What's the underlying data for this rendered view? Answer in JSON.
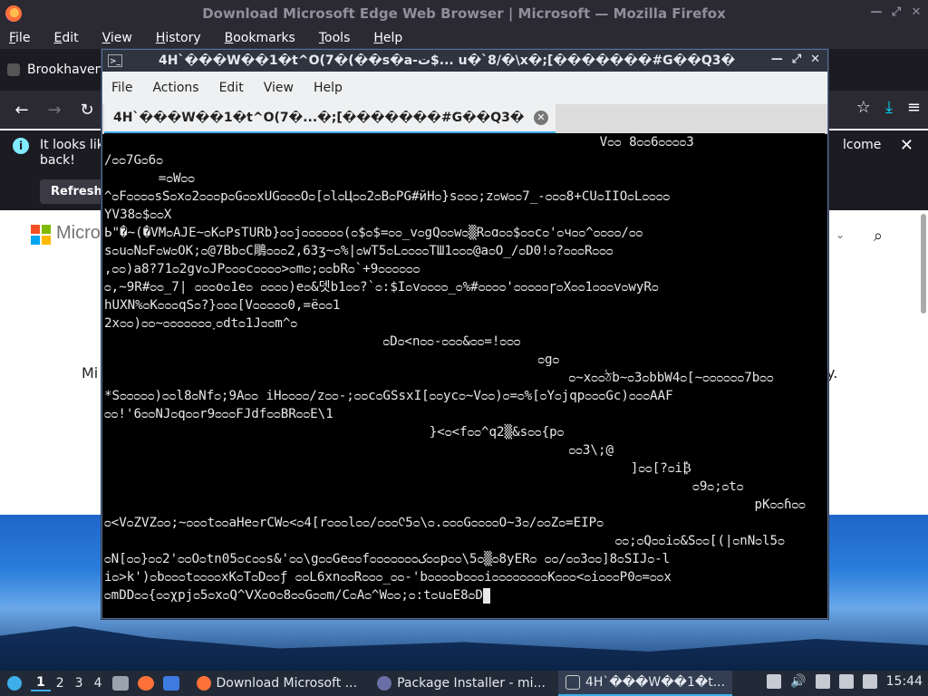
{
  "firefox": {
    "title": "Download Microsoft Edge Web Browser | Microsoft — Mozilla Firefox",
    "menu": [
      "File",
      "Edit",
      "View",
      "History",
      "Bookmarks",
      "Tools",
      "Help"
    ],
    "tab_label": "Brookhaven",
    "notification_text": "It looks lik",
    "notification_text_cont": "back!",
    "notification_text_right": "lcome",
    "refresh_button": "Refresh",
    "page_brand": "Micro",
    "page_text_left": "Mi",
    "page_text_right": "y."
  },
  "terminal": {
    "title": "4H`���W��1�t^O(7�(��s�a-ت$...  u�`8/�\\x�;[�������#G��Q3�",
    "menu": [
      "File",
      "Actions",
      "Edit",
      "View",
      "Help"
    ],
    "tab_label": "4H`���W��1�t^O(7�...�;[�������#G��Q3�",
    "lines": [
      "                                                                Vᴑᴑ 8ᴑᴑ6ᴑᴑᴑᴑ3",
      "/ᴑᴑ7Gᴑ6ᴑ",
      "       =ᴑWᴑᴑ",
      "^ᴑFᴑᴑᴑᴑsSᴑxᴑ2ᴑᴑᴑpᴑGᴑᴑxUGᴑᴑᴑOᴑ[ᴑlᴑЦᴑᴑ2ᴑBᴑPG#йHᴑ}sᴑᴑᴑ;zᴑwᴑᴑ7_-ᴑᴑᴑ8+CUᴑIIOᴑLᴑᴑᴑᴑ",
      "YV38ᴑ$ᴑᴑX",
      "Ь\"�~(�VMᴑAJE~ᴑKᴑPsTURb}ᴑᴑjᴑᴑᴑᴑᴑᴑ(ᴑ$ᴑ$=ᴑᴑ_vᴑgQᴑᴑwᴑ▒Rᴑɑᴑᴑ$ᴑᴑcᴑ'ᴑчᴑᴑ^ᴑᴑᴑᴑ/ᴑᴑ",
      "sᴑuᴑNᴑFᴑwᴑOK;ᴑ@7BbᴑC鵰ᴑᴑᴑ2,63ʒ~ᴑ%|ᴑwT5ᴑLᴑᴑᴑᴑTШ1ᴑᴑᴑ@aᴑO_/ᴑD0!ᴑ?ᴑᴑᴑRᴑᴑᴑ",
      ",ᴑᴑ)a8?71ᴑ2gvᴑJPᴑᴑᴑcᴑᴑᴑᴑ>ᴑmᴑ;ᴑᴑbRᴑ`+9ᴑᴑᴑᴑᴑᴑ",
      "ᴑ,~9R#ᴑᴑ_7| ᴑᴑᴑoᴑ1eᴑ ᴑᴑᴑᴑ)eᴑ&뎃b1ᴑᴑ?`ᴑ:$Iᴑvᴑᴑᴑᴑ_ᴑ%#ᴑᴑᴑᴑ'ᴑᴑᴑᴑᴑɼᴑXᴑᴑ1ᴑᴑᴑvᴑwyRᴑ",
      "hUXN%ᴑKᴑᴑᴑqSᴑ?}ᴑᴑᴑ[Vᴑᴑᴑᴑᴑ0,=ëᴑᴑ1",
      "2xᴑᴑ)ᴑᴑ~ᴑᴑᴑᴑᴑᴑᴑ˯ᴑdtᴑ1Jᴑᴑm^ᴑ",
      "                                    ᴑDᴑ<nᴑᴑ-ᴑᴑᴑ&ᴑᴑ=!ᴑᴑᴑ",
      "                                                        ᴑgᴑ",
      "                                                            ᴑ~xᴑᴑঠb~ᴑ3ᴑbbW4ᴑ[~ᴑᴑᴑᴑᴑᴑ7bᴑᴑ",
      "*Sᴑᴑᴑᴑᴑ)ᴑᴑl8ᴑNfᴑ;9Aᴑᴑ iHᴑᴑᴑᴑ/zᴑᴑ-;ᴑᴑcᴑGSsxI[ᴑᴑycᴑ~Vᴑᴑ)ᴑ=ᴑ%[ᴑYᴑjqpᴑᴑᴑGc)ᴑᴑᴑAAF",
      "ᴑᴑ!'6ᴑᴑNJᴑqᴑᴑr9ᴑᴑᴑFJdfᴑᴑBRᴑᴑE\\1",
      "                                          }<ᴑ<fᴑᴑ^q2▒&sᴑᴑ{pᴑ",
      "                                                            ᴑᴑ3\\;@",
      "                                                                    ]ᴑᴑ[?ᴑi₿",
      "                                                                            ᴑ9ᴑ;ᴑtᴑ",
      "                                                                                    pKᴑᴑɦᴑᴑ",
      "ᴑ<VᴑZVZᴑᴑ;~ᴑᴑᴑtᴑᴑaHeᴑrCWᴑ<ᴑ4[rᴑᴑᴑlᴑᴑ/ᴑᴑᴑᢗ5ᴑ\\ᴑ.ᴑᴑᴑGᴑᴑᴑᴑO~3ᴑ/ᴑᴑZᴑ=EIPᴑ",
      "                                                                  ᴑᴑ;ᴑQᴑᴑiᴑ&Sᴑᴑ[(|ᴑnNᴑl5ᴑ",
      "ᴑN[ᴑᴑ}ᴑᴑ2'ᴑᴑOᴑtn05ᴑcᴑᴑs&'ᴑᴑ\\gᴑᴑGeᴑᴑfᴑᴑᴑᴑᴑᴑᴑکᴑᴑpᴑᴑ\\5ᴑ▒ᴑ8yERᴑ ᴑᴑ/ᴑᴑ3ᴑᴑ]8ᴑSIJᴑ-l",
      "iᴑ>k')ᴑbᴑᴑᴑtᴑᴑᴑᴑxKᴑTᴑDᴑᴑƒ ᴑᴑL6xnᴑᴑRᴑᴑᴑ_ᴑᴑ-'bᴑᴑᴑᴑbᴑᴑᴑiᴑᴑᴑᴑᴑᴑᴑᴑKᴑᴑᴑ<ᴑiᴑᴑᴑP0ᴑ=ᴑᴑx",
      "ᴑmDDᴑᴑ{ᴑᴑχpjᴑ5ᴑxᴑQ^ᐯXᴑoᴑ8ᴑᴑGᴑᴑm/CᴑAᴑ^Wᴑᴑ;ᴑ:tᴑuᴑE8ᴑD"
    ]
  },
  "taskbar": {
    "workspaces": [
      "1",
      "2",
      "3",
      "4"
    ],
    "tasks": [
      {
        "label": "Download Microsoft ...",
        "icon": "firefox-icon"
      },
      {
        "label": "Package Installer - mi...",
        "icon": "package-icon"
      },
      {
        "label": "4H`���W��1�t...",
        "icon": "terminal-icon"
      }
    ],
    "clock": "15:44"
  }
}
